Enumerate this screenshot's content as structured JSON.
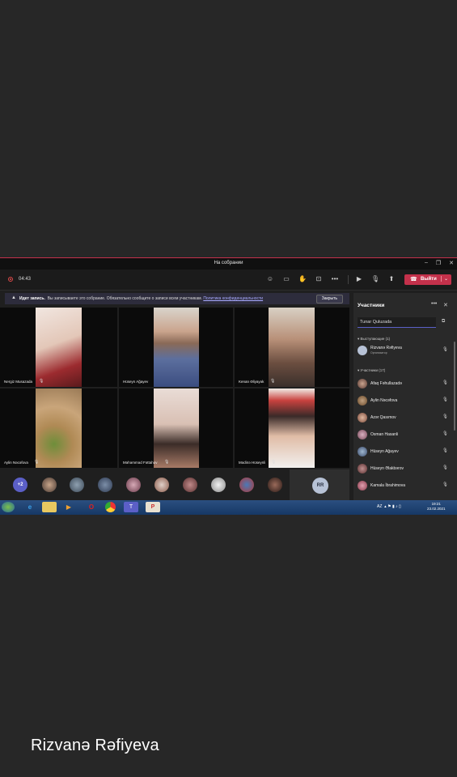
{
  "window": {
    "title": "На собрании"
  },
  "toolbar": {
    "timer": "04:43",
    "leave_label": "Выйти"
  },
  "banner": {
    "bold": "Идет запись.",
    "text": "Вы записываете это собрание. Обязательно сообщите о записи всем участникам.",
    "link": "Политика конфиденциальности",
    "close_label": "Закрыть"
  },
  "tiles": [
    {
      "name": "Nergiz Musazada"
    },
    {
      "name": "Hüseyn Ağayev"
    },
    {
      "name": "Kenan Əliyayək"
    },
    {
      "name": "Aylin Nəcəfova"
    },
    {
      "name": "Məhəmməd Fəttahov"
    },
    {
      "name": "Mədinə Hüseynli"
    }
  ],
  "dock": {
    "more_label": "+2",
    "self_initials": "RR"
  },
  "panel": {
    "title": "Участники",
    "search_value": "Tunar Quluzada",
    "presenters_header": "Выступающие (1)",
    "presenter": {
      "name": "Rizvanə Rəfiyeva",
      "role": "Организатор"
    },
    "attendees_header": "Участники (17)",
    "attendees": [
      {
        "name": "Afaq Fəhullazadə"
      },
      {
        "name": "Aylin Nəcəfova"
      },
      {
        "name": "Azər Qasımov"
      },
      {
        "name": "Osman Hasanli"
      },
      {
        "name": "Hüseyn Ağayev"
      },
      {
        "name": "Hüseyn Əlakbərov"
      },
      {
        "name": "Kamala İbrahimova"
      }
    ]
  },
  "taskbar": {
    "lang": "AZ",
    "time": "19:21",
    "date": "23.02.2021"
  },
  "caption": "Rizvanə Rəfiyeva"
}
